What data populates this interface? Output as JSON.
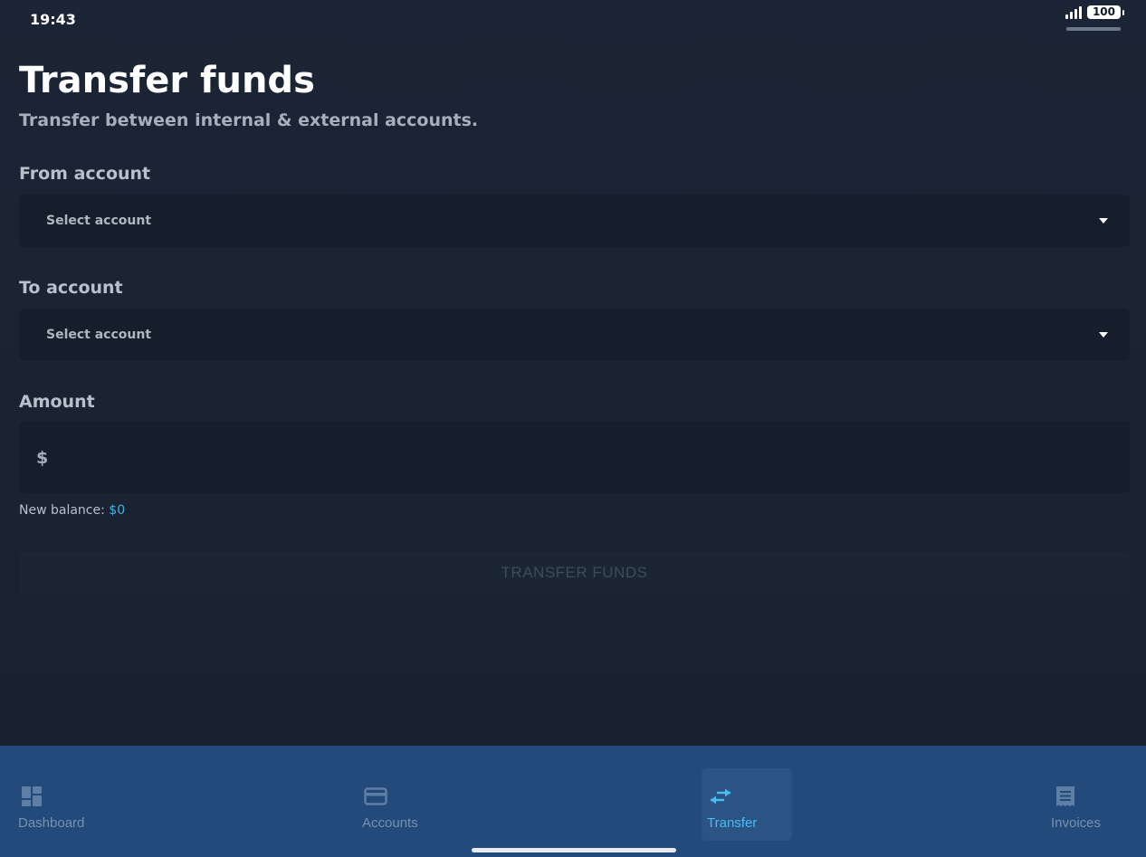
{
  "status_bar": {
    "time": "19:43",
    "battery": "100"
  },
  "header": {
    "title": "Transfer funds",
    "subtitle": "Transfer between internal & external accounts."
  },
  "form": {
    "from_label": "From account",
    "from_value": "Select account",
    "to_label": "To account",
    "to_value": "Select account",
    "amount_label": "Amount",
    "currency_symbol": "$",
    "amount_value": "",
    "new_balance_label": "New balance:",
    "new_balance_value": "$0",
    "submit_label": "TRANSFER FUNDS"
  },
  "nav": {
    "items": [
      {
        "label": "Dashboard",
        "icon": "dashboard-icon",
        "active": false
      },
      {
        "label": "Accounts",
        "icon": "credit-card-icon",
        "active": false
      },
      {
        "label": "Transfer",
        "icon": "transfer-arrows-icon",
        "active": true
      },
      {
        "label": "Invoices",
        "icon": "invoice-icon",
        "active": false
      }
    ]
  },
  "colors": {
    "background": "#1b2535",
    "input_background": "#151e2a",
    "accent": "#48bdf0",
    "nav_background": "#224a7a",
    "nav_inactive": "#7891b0"
  }
}
